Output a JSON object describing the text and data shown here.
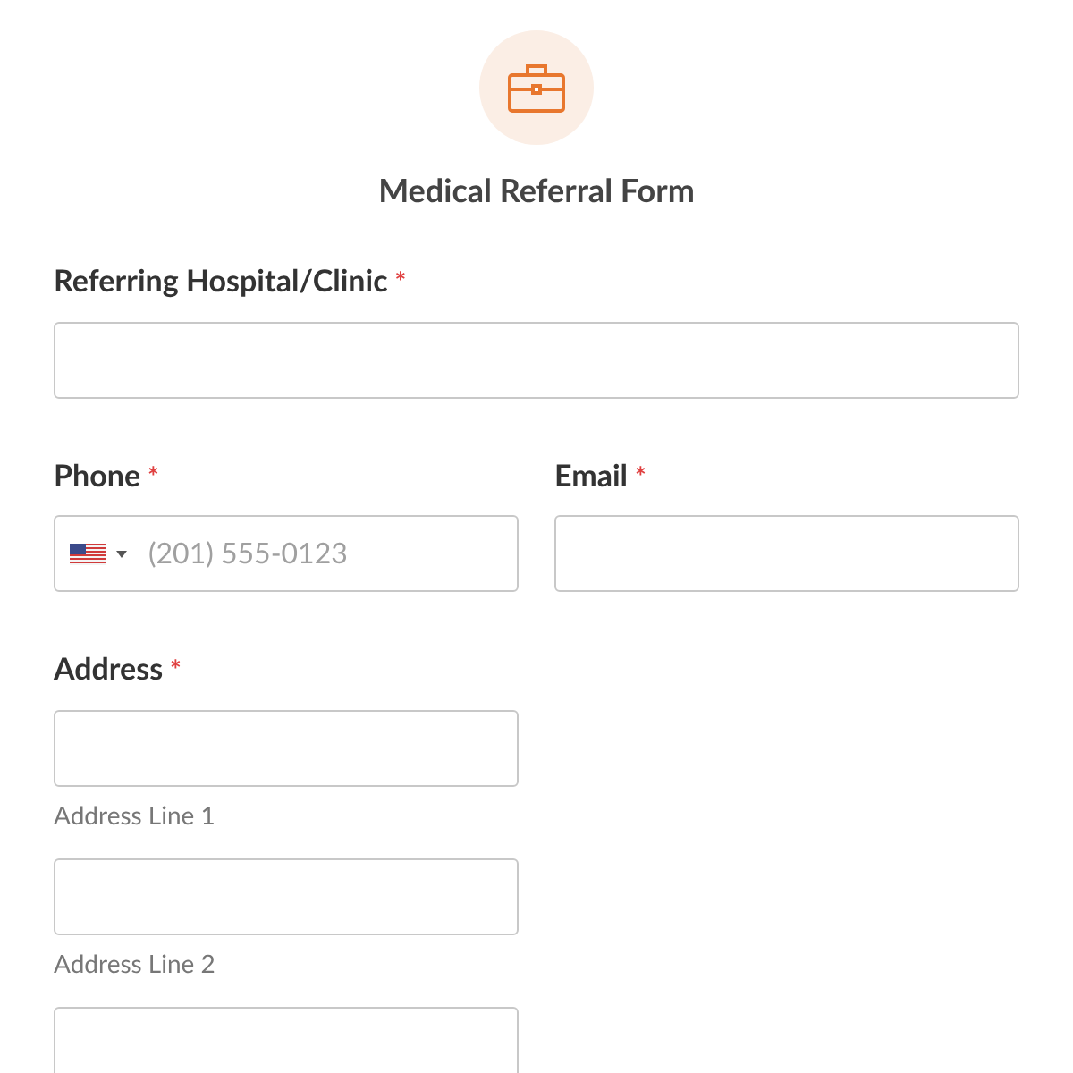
{
  "form": {
    "title": "Medical Referral Form"
  },
  "hospital": {
    "label": "Referring Hospital/Clinic",
    "required_mark": "*"
  },
  "phone": {
    "label": "Phone",
    "required_mark": "*",
    "placeholder": "(201) 555-0123"
  },
  "email": {
    "label": "Email",
    "required_mark": "*"
  },
  "address": {
    "label": "Address",
    "required_mark": "*",
    "lines": [
      {
        "kind": "line",
        "sublabel": "Address Line 1"
      },
      {
        "kind": "line",
        "sublabel": "Address Line 2"
      },
      {
        "kind": "line"
      }
    ]
  }
}
